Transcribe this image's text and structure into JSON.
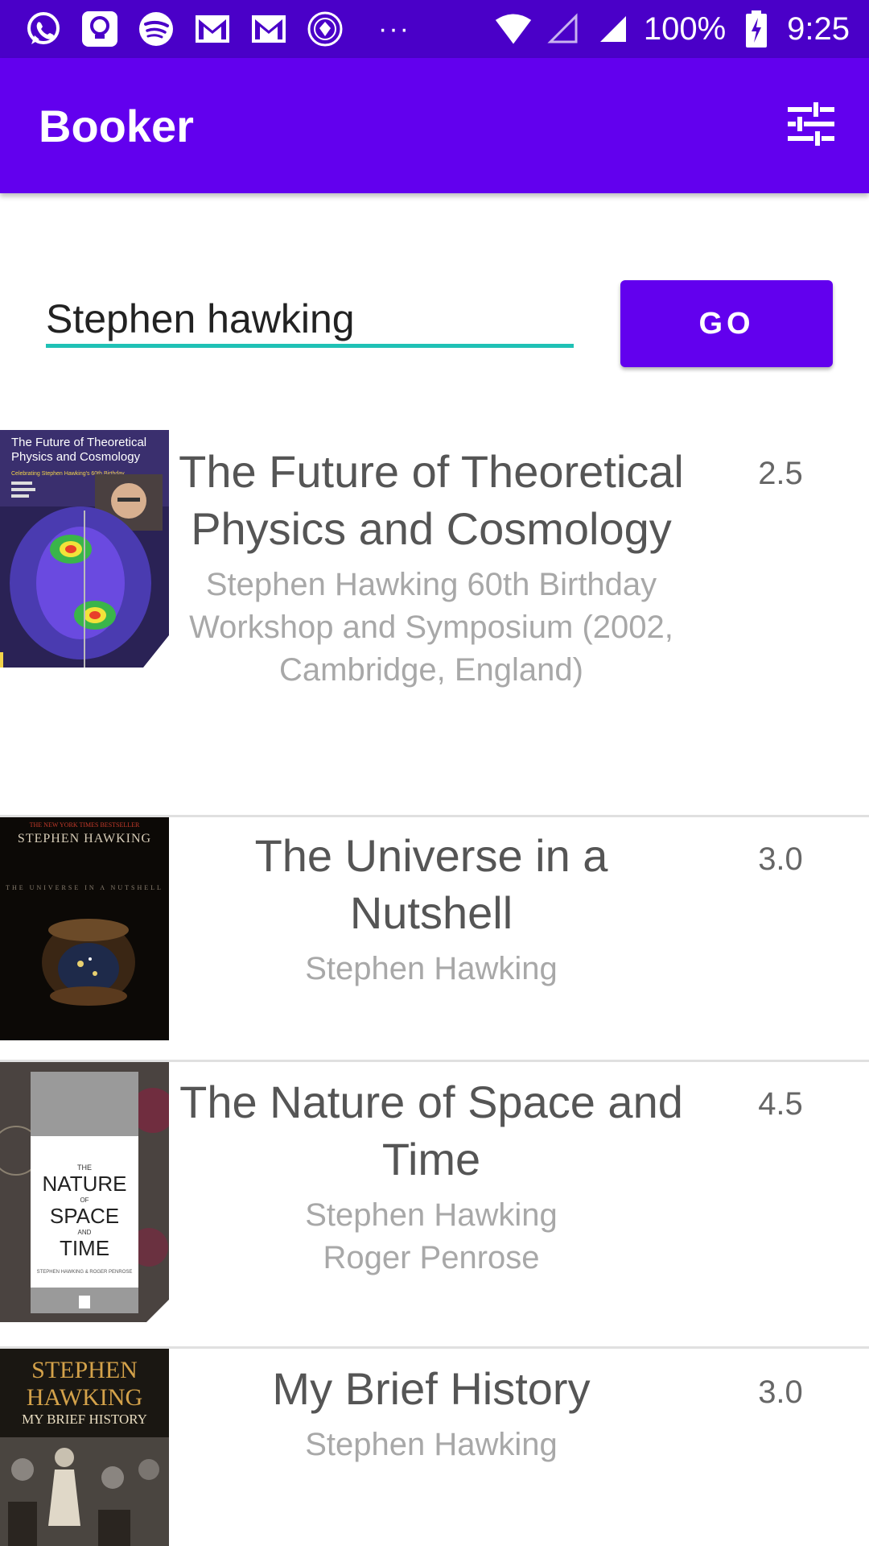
{
  "status_bar": {
    "notification_icons": [
      "whatsapp-icon",
      "bulb-notification-icon",
      "spotify-icon",
      "gmail-icon",
      "gmail-icon",
      "club-crest-icon"
    ],
    "more": "···",
    "battery": "100%",
    "time": "9:25"
  },
  "app_bar": {
    "title": "Booker",
    "filter_icon": "tune-icon"
  },
  "search": {
    "value": "Stephen hawking",
    "button_label": "GO"
  },
  "colors": {
    "primary": "#6200ee",
    "primary_dark": "#4a00c8",
    "accent": "#1fc1b5"
  },
  "books": [
    {
      "title": "The Future of Theoretical Physics and Cosmology",
      "authors": [
        "Stephen Hawking 60th Birthday Workshop and Symposium (2002, Cambridge, England)"
      ],
      "rating": "2.5",
      "cover_text": [
        "The Future of Theoretical",
        "Physics and Cosmology",
        "Celebrating Stephen Hawking's 60th Birthday"
      ]
    },
    {
      "title": "The Universe in a Nutshell",
      "authors": [
        "Stephen Hawking"
      ],
      "rating": "3.0",
      "cover_text": [
        "THE NEW YORK TIMES BESTSELLER",
        "STEPHEN HAWKING",
        "THE UNIVERSE IN A NUTSHELL"
      ]
    },
    {
      "title": "The Nature of Space and Time",
      "authors": [
        "Stephen Hawking",
        "Roger Penrose"
      ],
      "rating": "4.5",
      "cover_text": [
        "THE",
        "NATURE",
        "OF",
        "SPACE",
        "AND",
        "TIME",
        "STEPHEN HAWKING & ROGER PENROSE"
      ]
    },
    {
      "title": "My Brief History",
      "authors": [
        "Stephen Hawking"
      ],
      "rating": "3.0",
      "cover_text": [
        "STEPHEN",
        "HAWKING",
        "MY BRIEF HISTORY"
      ]
    }
  ]
}
